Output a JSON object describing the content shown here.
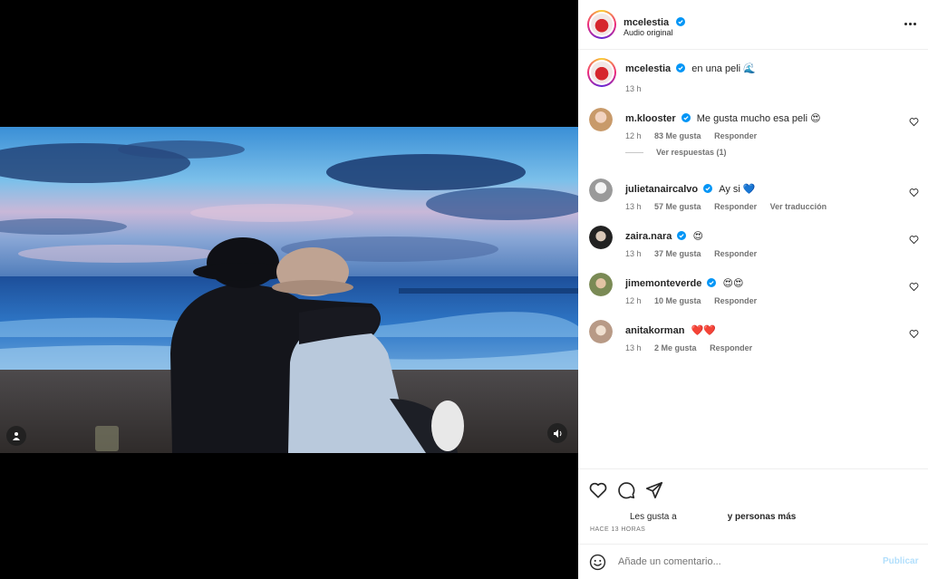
{
  "post": {
    "author": "mcelestia",
    "audio": "Audio original",
    "caption": {
      "username": "mcelestia",
      "text": "en una peli 🌊",
      "time": "13 h"
    }
  },
  "comments": [
    {
      "username": "m.klooster",
      "text": "Me gusta mucho esa peli 😍",
      "time": "12 h",
      "likes": "83 Me gusta",
      "reply": "Responder",
      "view_replies": "Ver respuestas (1)"
    },
    {
      "username": "julietanaircalvo",
      "text": "Ay si 💙",
      "time": "13 h",
      "likes": "57 Me gusta",
      "reply": "Responder",
      "translate": "Ver traducción"
    },
    {
      "username": "zaira.nara",
      "text": "😍",
      "time": "13 h",
      "likes": "37 Me gusta",
      "reply": "Responder"
    },
    {
      "username": "jimemonteverde",
      "text": "😍😍",
      "time": "12 h",
      "likes": "10 Me gusta",
      "reply": "Responder"
    },
    {
      "username": "anitakorman",
      "text": "❤️❤️",
      "time": "13 h",
      "likes": "2 Me gusta",
      "reply": "Responder"
    }
  ],
  "footer": {
    "likes_prefix": "Les gusta a",
    "likes_suffix": "y personas más",
    "time_ago": "HACE 13 HORAS",
    "comment_placeholder": "Añade un comentario...",
    "post_label": "Publicar"
  },
  "icons": {
    "more": "more-options-icon",
    "heart": "heart-icon",
    "comment": "comment-icon",
    "share": "share-icon",
    "emoji": "emoji-icon",
    "tag": "user-tag-icon",
    "sound": "sound-icon",
    "verified": "verified-badge-icon"
  },
  "colors": {
    "verified": "#0095f6",
    "publish_disabled": "#b2dffc",
    "muted_text": "#737373"
  }
}
